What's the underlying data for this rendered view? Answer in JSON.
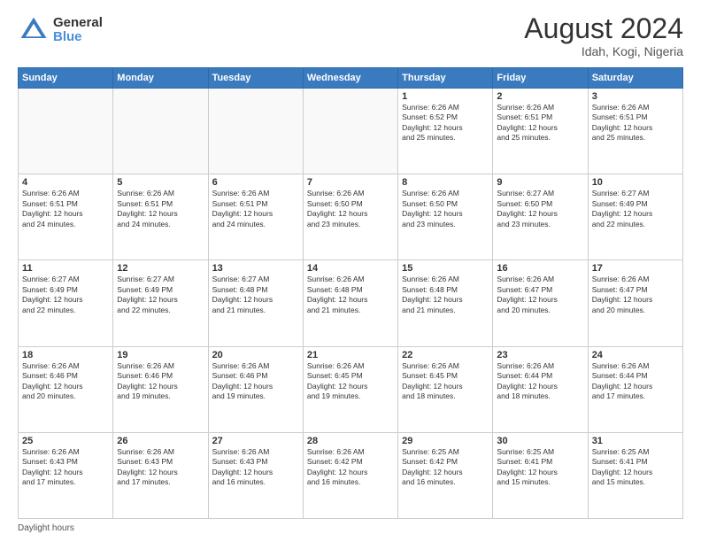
{
  "header": {
    "logo_general": "General",
    "logo_blue": "Blue",
    "month_title": "August 2024",
    "location": "Idah, Kogi, Nigeria"
  },
  "days_of_week": [
    "Sunday",
    "Monday",
    "Tuesday",
    "Wednesday",
    "Thursday",
    "Friday",
    "Saturday"
  ],
  "weeks": [
    [
      {
        "day": "",
        "info": ""
      },
      {
        "day": "",
        "info": ""
      },
      {
        "day": "",
        "info": ""
      },
      {
        "day": "",
        "info": ""
      },
      {
        "day": "1",
        "info": "Sunrise: 6:26 AM\nSunset: 6:52 PM\nDaylight: 12 hours\nand 25 minutes."
      },
      {
        "day": "2",
        "info": "Sunrise: 6:26 AM\nSunset: 6:51 PM\nDaylight: 12 hours\nand 25 minutes."
      },
      {
        "day": "3",
        "info": "Sunrise: 6:26 AM\nSunset: 6:51 PM\nDaylight: 12 hours\nand 25 minutes."
      }
    ],
    [
      {
        "day": "4",
        "info": "Sunrise: 6:26 AM\nSunset: 6:51 PM\nDaylight: 12 hours\nand 24 minutes."
      },
      {
        "day": "5",
        "info": "Sunrise: 6:26 AM\nSunset: 6:51 PM\nDaylight: 12 hours\nand 24 minutes."
      },
      {
        "day": "6",
        "info": "Sunrise: 6:26 AM\nSunset: 6:51 PM\nDaylight: 12 hours\nand 24 minutes."
      },
      {
        "day": "7",
        "info": "Sunrise: 6:26 AM\nSunset: 6:50 PM\nDaylight: 12 hours\nand 23 minutes."
      },
      {
        "day": "8",
        "info": "Sunrise: 6:26 AM\nSunset: 6:50 PM\nDaylight: 12 hours\nand 23 minutes."
      },
      {
        "day": "9",
        "info": "Sunrise: 6:27 AM\nSunset: 6:50 PM\nDaylight: 12 hours\nand 23 minutes."
      },
      {
        "day": "10",
        "info": "Sunrise: 6:27 AM\nSunset: 6:49 PM\nDaylight: 12 hours\nand 22 minutes."
      }
    ],
    [
      {
        "day": "11",
        "info": "Sunrise: 6:27 AM\nSunset: 6:49 PM\nDaylight: 12 hours\nand 22 minutes."
      },
      {
        "day": "12",
        "info": "Sunrise: 6:27 AM\nSunset: 6:49 PM\nDaylight: 12 hours\nand 22 minutes."
      },
      {
        "day": "13",
        "info": "Sunrise: 6:27 AM\nSunset: 6:48 PM\nDaylight: 12 hours\nand 21 minutes."
      },
      {
        "day": "14",
        "info": "Sunrise: 6:26 AM\nSunset: 6:48 PM\nDaylight: 12 hours\nand 21 minutes."
      },
      {
        "day": "15",
        "info": "Sunrise: 6:26 AM\nSunset: 6:48 PM\nDaylight: 12 hours\nand 21 minutes."
      },
      {
        "day": "16",
        "info": "Sunrise: 6:26 AM\nSunset: 6:47 PM\nDaylight: 12 hours\nand 20 minutes."
      },
      {
        "day": "17",
        "info": "Sunrise: 6:26 AM\nSunset: 6:47 PM\nDaylight: 12 hours\nand 20 minutes."
      }
    ],
    [
      {
        "day": "18",
        "info": "Sunrise: 6:26 AM\nSunset: 6:46 PM\nDaylight: 12 hours\nand 20 minutes."
      },
      {
        "day": "19",
        "info": "Sunrise: 6:26 AM\nSunset: 6:46 PM\nDaylight: 12 hours\nand 19 minutes."
      },
      {
        "day": "20",
        "info": "Sunrise: 6:26 AM\nSunset: 6:46 PM\nDaylight: 12 hours\nand 19 minutes."
      },
      {
        "day": "21",
        "info": "Sunrise: 6:26 AM\nSunset: 6:45 PM\nDaylight: 12 hours\nand 19 minutes."
      },
      {
        "day": "22",
        "info": "Sunrise: 6:26 AM\nSunset: 6:45 PM\nDaylight: 12 hours\nand 18 minutes."
      },
      {
        "day": "23",
        "info": "Sunrise: 6:26 AM\nSunset: 6:44 PM\nDaylight: 12 hours\nand 18 minutes."
      },
      {
        "day": "24",
        "info": "Sunrise: 6:26 AM\nSunset: 6:44 PM\nDaylight: 12 hours\nand 17 minutes."
      }
    ],
    [
      {
        "day": "25",
        "info": "Sunrise: 6:26 AM\nSunset: 6:43 PM\nDaylight: 12 hours\nand 17 minutes."
      },
      {
        "day": "26",
        "info": "Sunrise: 6:26 AM\nSunset: 6:43 PM\nDaylight: 12 hours\nand 17 minutes."
      },
      {
        "day": "27",
        "info": "Sunrise: 6:26 AM\nSunset: 6:43 PM\nDaylight: 12 hours\nand 16 minutes."
      },
      {
        "day": "28",
        "info": "Sunrise: 6:26 AM\nSunset: 6:42 PM\nDaylight: 12 hours\nand 16 minutes."
      },
      {
        "day": "29",
        "info": "Sunrise: 6:25 AM\nSunset: 6:42 PM\nDaylight: 12 hours\nand 16 minutes."
      },
      {
        "day": "30",
        "info": "Sunrise: 6:25 AM\nSunset: 6:41 PM\nDaylight: 12 hours\nand 15 minutes."
      },
      {
        "day": "31",
        "info": "Sunrise: 6:25 AM\nSunset: 6:41 PM\nDaylight: 12 hours\nand 15 minutes."
      }
    ]
  ],
  "footer": {
    "note": "Daylight hours"
  }
}
